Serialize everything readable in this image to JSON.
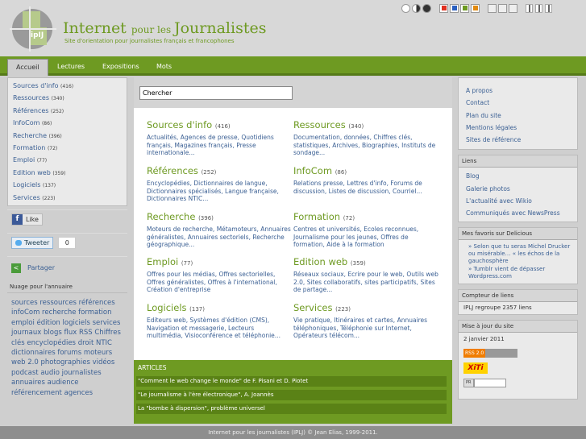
{
  "header": {
    "logo_text": "ipIJ",
    "title_part1": "Internet ",
    "title_small": "pour les ",
    "title_part2": "Journalistes",
    "subtitle": "Site d'orientation pour journalistes français et francophones"
  },
  "style_switcher": {
    "colors": [
      "#ffffff",
      "#e03020",
      "#2a5fc0",
      "#6e9a22",
      "#e28a10"
    ]
  },
  "nav": {
    "tabs": [
      "Accueil",
      "Lectures",
      "Expositions",
      "Mots"
    ]
  },
  "left_menu": [
    {
      "label": "Sources d'info",
      "count": "(416)"
    },
    {
      "label": "Ressources",
      "count": "(340)"
    },
    {
      "label": "Références",
      "count": "(252)"
    },
    {
      "label": "InfoCom",
      "count": "(86)"
    },
    {
      "label": "Recherche",
      "count": "(396)"
    },
    {
      "label": "Formation",
      "count": "(72)"
    },
    {
      "label": "Emploi",
      "count": "(77)"
    },
    {
      "label": "Edition web",
      "count": "(359)"
    },
    {
      "label": "Logiciels",
      "count": "(137)"
    },
    {
      "label": "Services",
      "count": "(223)"
    }
  ],
  "social": {
    "like": "Like",
    "tweet": "Tweeter",
    "tweet_count": "0",
    "share": "Partager"
  },
  "cloud": {
    "title": "Nuage pour l'annuaire",
    "text": "sources ressources références infoCom recherche formation emploi édition logiciels services journaux blogs flux RSS Chiffres clés encyclopédies droit NTIC dictionnaires forums moteurs web 2.0 photographies vidéos podcast audio journalistes annuaires audience référencement agences"
  },
  "search": {
    "placeholder": "Chercher"
  },
  "categories": [
    {
      "title": "Sources d'info",
      "count": "(416)",
      "desc": "Actualités, Agences de presse, Quotidiens français, Magazines français, Presse internationale..."
    },
    {
      "title": "Ressources",
      "count": "(340)",
      "desc": "Documentation, données, Chiffres clés, statistiques, Archives, Biographies, Instituts de sondage..."
    },
    {
      "title": "Références",
      "count": "(252)",
      "desc": "Encyclopédies, Dictionnaires de langue, Dictionnaires spécialisés, Langue française, Dictionnaires NTIC..."
    },
    {
      "title": "InfoCom",
      "count": "(86)",
      "desc": "Relations presse, Lettres d'info, Forums de discussion, Listes de discussion, Courriel..."
    },
    {
      "title": "Recherche",
      "count": "(396)",
      "desc": "Moteurs de recherche, Métamoteurs, Annuaires généralistes, Annuaires sectoriels, Recherche géographique..."
    },
    {
      "title": "Formation",
      "count": "(72)",
      "desc": "Centres et universités, Ecoles reconnues, Journalisme pour les jeunes, Offres de formation, Aide à la formation"
    },
    {
      "title": "Emploi",
      "count": "(77)",
      "desc": "Offres pour les médias, Offres sectorielles, Offres généralistes, Offres à l'international, Création d'entreprise"
    },
    {
      "title": "Edition web",
      "count": "(359)",
      "desc": "Réseaux sociaux, Ecrire pour le web, Outils web 2.0, Sites collaboratifs, sites participatifs, Sites de partage..."
    },
    {
      "title": "Logiciels",
      "count": "(137)",
      "desc": "Editeurs web, Systèmes d'édition (CMS), Navigation et messagerie, Lecteurs multimédia, Visioconférence et téléphonie..."
    },
    {
      "title": "Services",
      "count": "(223)",
      "desc": "Vie pratique, Itinéraires et cartes, Annuaires téléphoniques, Téléphonie sur Internet, Opérateurs télécom..."
    }
  ],
  "articles": {
    "heading": "ARTICLES",
    "items": [
      {
        "title": "\"Comment le web change le monde\"",
        "author": " de F. Pisani et D. Piotet"
      },
      {
        "title": "\"Le journalisme à l'ère électronique\"",
        "author": ", A. Joannès"
      },
      {
        "title": "La \"bombe à dispersion\", problème universel",
        "author": ""
      }
    ]
  },
  "right": {
    "links": [
      "A propos",
      "Contact",
      "Plan du site",
      "Mentions légales",
      "Sites de référence"
    ],
    "liens_title": "Liens",
    "liens": [
      "Blog",
      "Galerie photos",
      "L'actualité avec Wikio",
      "Communiqués avec NewsPress"
    ],
    "delicious_title": "Mes favoris sur Delicious",
    "delicious": [
      "» Selon que tu seras Michel Drucker ou misérable… « les échos de la gauchosphère",
      "» Tumblr vient de dépasser Wordpress.com"
    ],
    "counter_title": "Compteur de liens",
    "counter_text": "IPLJ regroupe 2357 liens",
    "update_title": "Mise à jour du site",
    "update_date": "2 janvier 2011",
    "rss_badge": "RSS 2.0",
    "xiti": "XiTi",
    "pr_badge": "PR"
  },
  "footer": {
    "text": "Internet pour les journalistes (IPLJ) © Jean Elias, 1999-2011."
  }
}
